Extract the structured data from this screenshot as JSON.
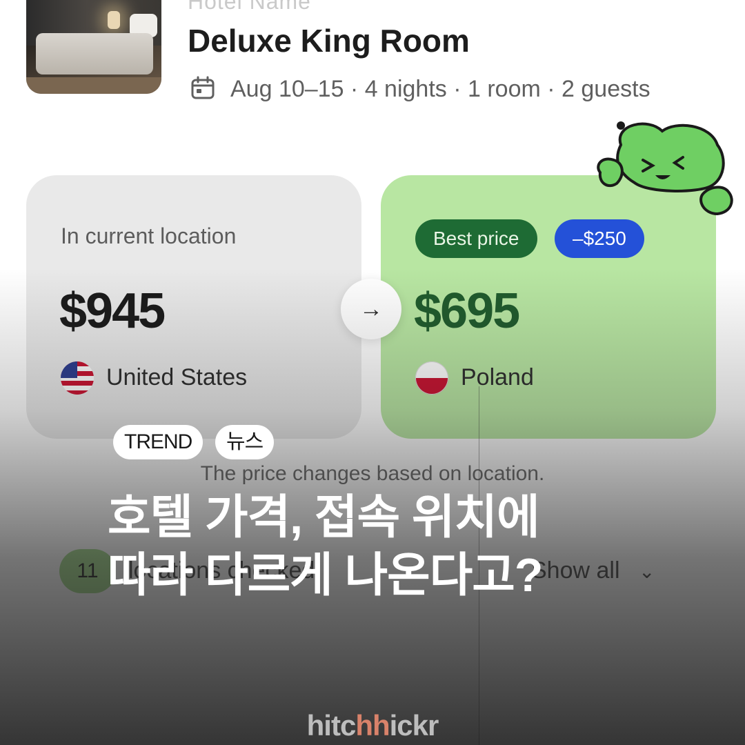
{
  "header": {
    "cut_text": "Hotel Name",
    "room_title": "Deluxe King Room",
    "trip_summary": "Aug 10–15 · 4 nights · 1 room · 2 guests"
  },
  "current_location": {
    "label": "In current location",
    "price": "$945",
    "country": "United States"
  },
  "best_location": {
    "badge_best": "Best price",
    "badge_savings": "–$250",
    "price": "$695",
    "country": "Poland"
  },
  "note": "The price changes based on location.",
  "locations": {
    "count": "11",
    "label": "locations checked",
    "show_all": "Show all"
  },
  "tags": [
    "TREND",
    "뉴스"
  ],
  "headline": {
    "line1": "호텔 가격, 접속 위치에",
    "line2": "따라 다르게 나온다고?"
  },
  "logo": {
    "part1": "hitc",
    "part2": "hh",
    "part3": "ickr"
  },
  "colors": {
    "best_card": "#b8e6a2",
    "best_badge": "#1e6b34",
    "savings_badge": "#2451d8",
    "price_green": "#1f5b2c"
  }
}
